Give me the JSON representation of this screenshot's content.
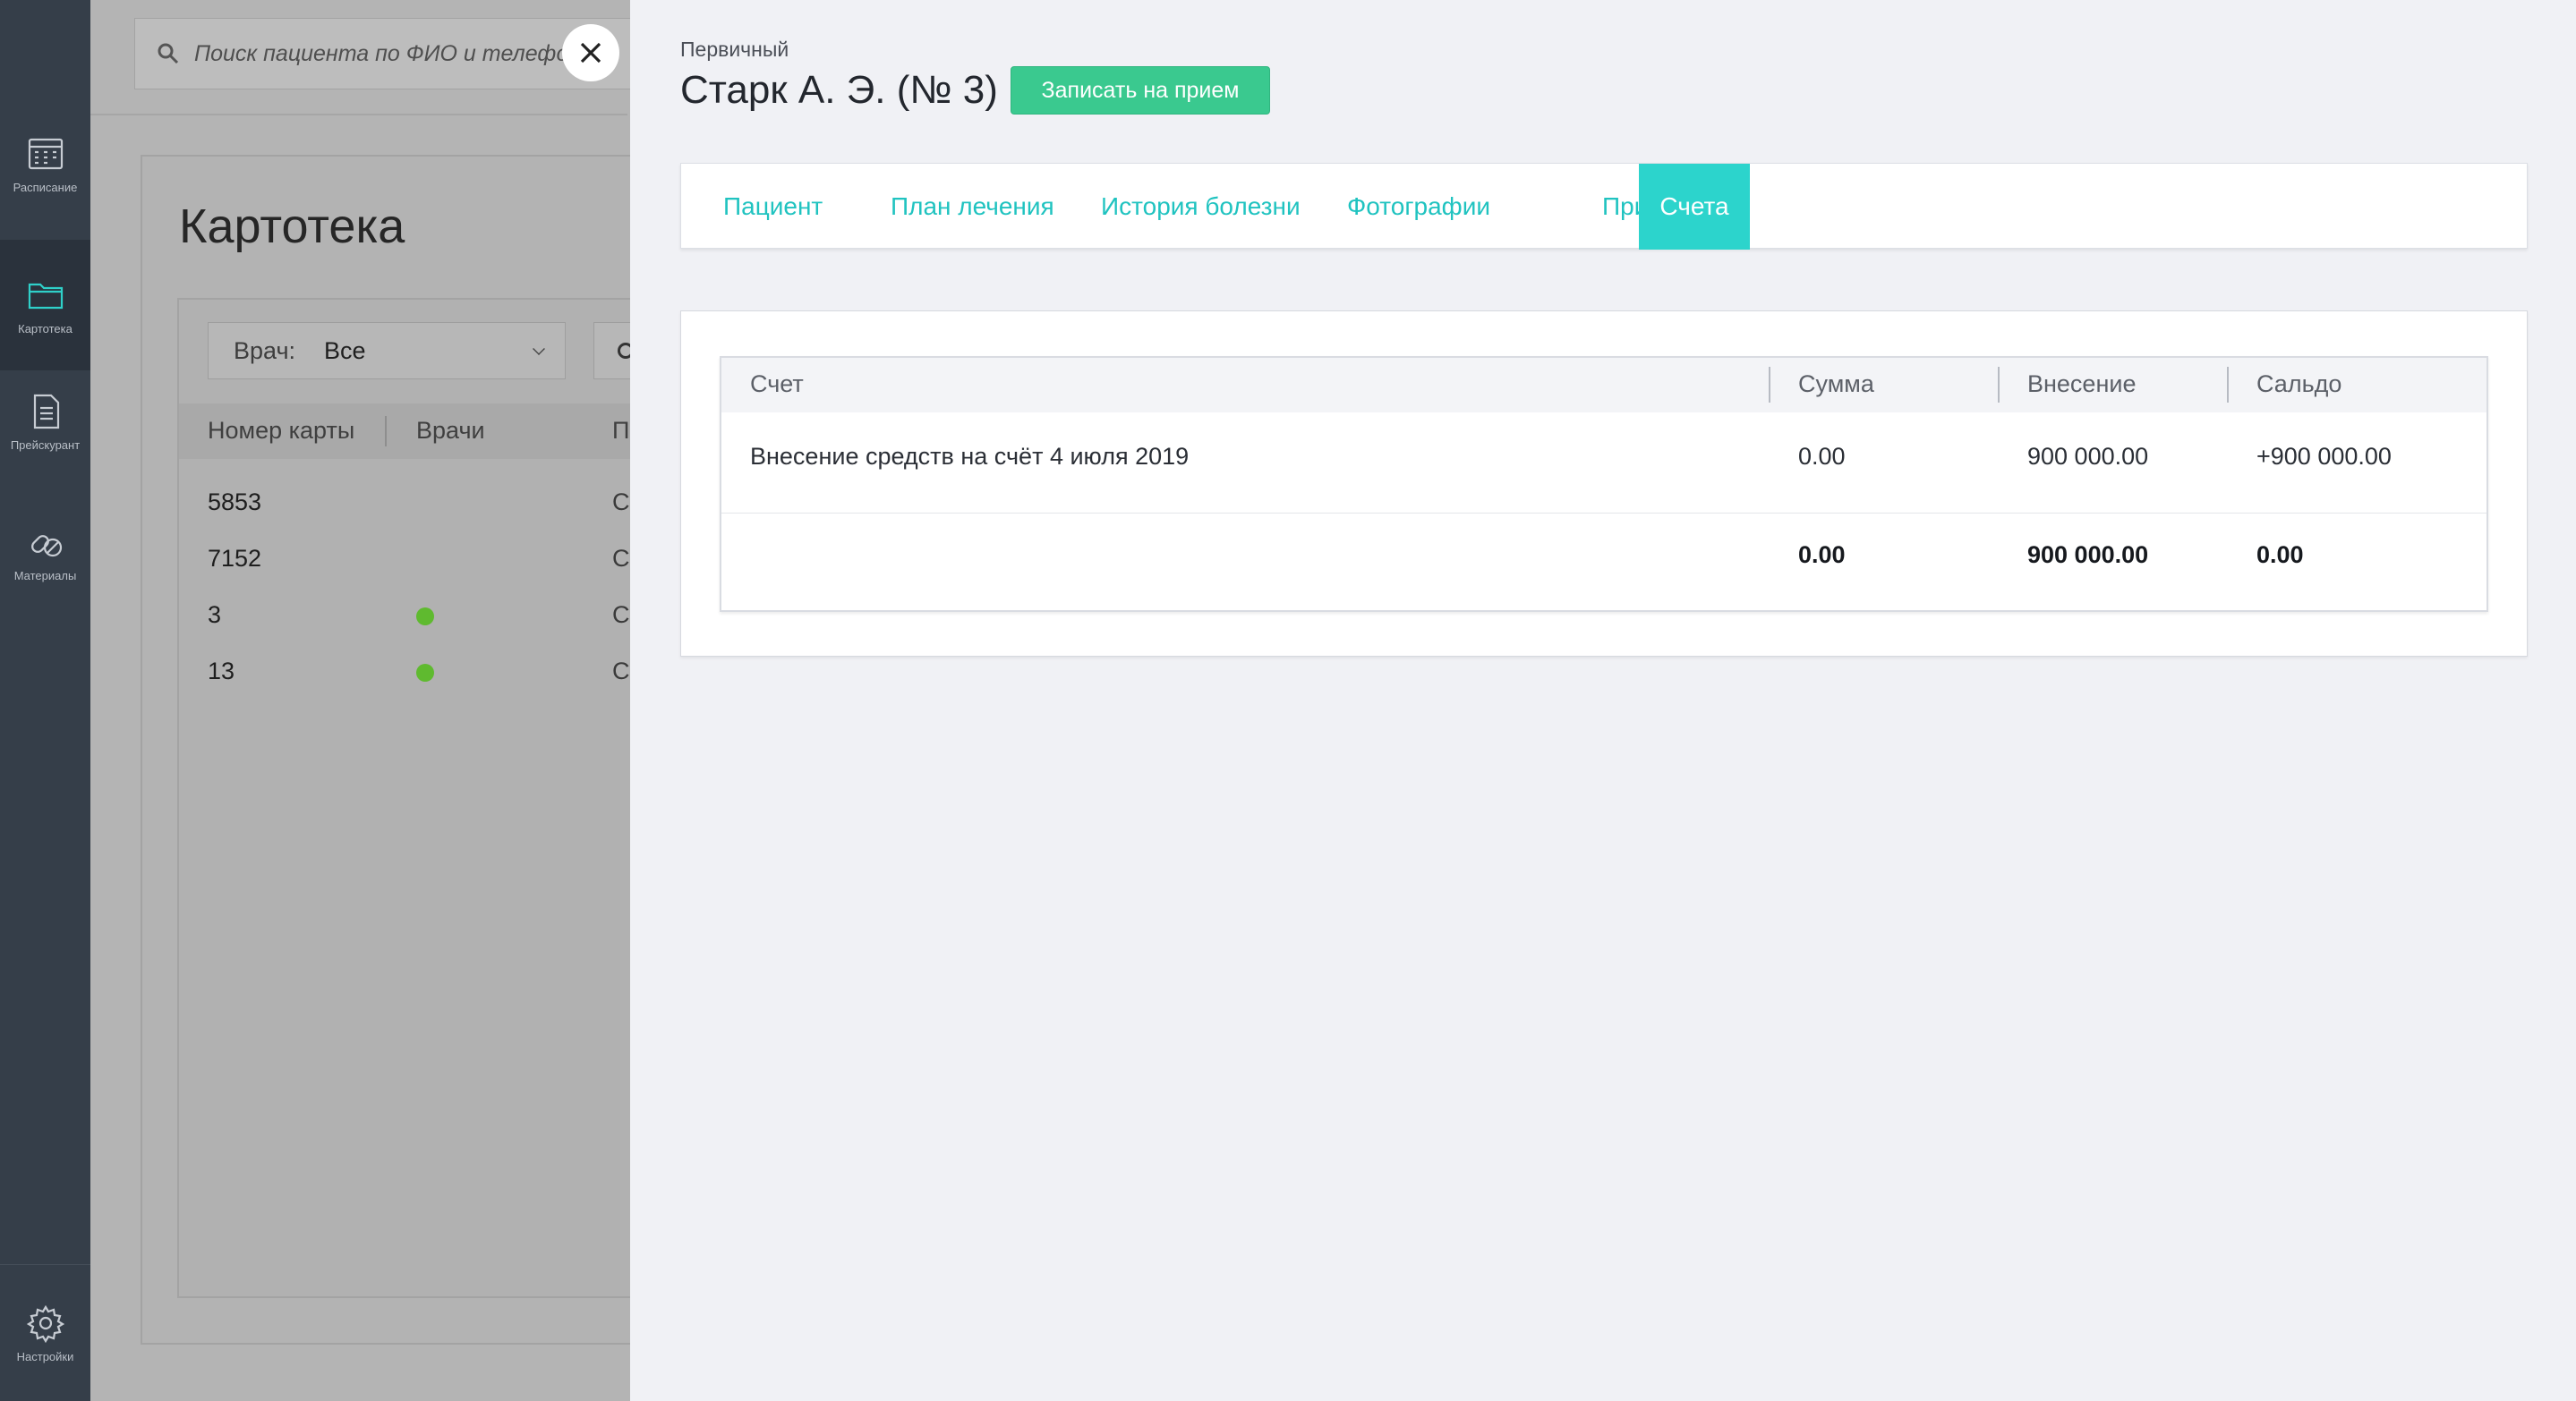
{
  "sidebar": {
    "items": [
      {
        "label": "Расписание",
        "icon": "calendar-icon"
      },
      {
        "label": "Картотека",
        "icon": "folder-icon"
      },
      {
        "label": "Прейскурант",
        "icon": "document-icon"
      },
      {
        "label": "Материалы",
        "icon": "pills-icon"
      }
    ],
    "settings": {
      "label": "Настройки",
      "icon": "gear-icon"
    }
  },
  "background": {
    "search_placeholder": "Поиск пациента по ФИО и телефону",
    "title": "Картотека",
    "doctor_filter": {
      "label": "Врач:",
      "value": "Все"
    },
    "columns": [
      "Номер карты",
      "Врачи",
      "П"
    ],
    "rows": [
      {
        "number": "5853",
        "doctor_dot": false,
        "col3": "С"
      },
      {
        "number": "7152",
        "doctor_dot": false,
        "col3": "С"
      },
      {
        "number": "3",
        "doctor_dot": true,
        "col3": "С"
      },
      {
        "number": "13",
        "doctor_dot": true,
        "col3": "С"
      }
    ]
  },
  "patient": {
    "status": "Первичный",
    "name": "Старк А. Э. (№ 3)",
    "appointment_button": "Записать на прием"
  },
  "tabs": [
    {
      "label": "Пациент",
      "active": false
    },
    {
      "label": "План лечения",
      "active": false
    },
    {
      "label": "История болезни",
      "active": false
    },
    {
      "label": "Фотографии",
      "active": false
    },
    {
      "label": "Приемы",
      "active": false
    },
    {
      "label": "Счета",
      "active": true
    }
  ],
  "accounts_table": {
    "columns": [
      "Счет",
      "Сумма",
      "Внесение",
      "Сальдо"
    ],
    "rows": [
      {
        "account": "Внесение средств на счёт 4 июля 2019",
        "sum": "0.00",
        "payment": "900 000.00",
        "balance": "+900 000.00"
      }
    ],
    "totals": {
      "sum": "0.00",
      "payment": "900 000.00",
      "balance": "0.00"
    }
  },
  "colors": {
    "accent": "#2cd4cc",
    "button_green": "#3ac98f",
    "sidebar": "#353e49",
    "doctor_dot": "#5fba2f"
  }
}
